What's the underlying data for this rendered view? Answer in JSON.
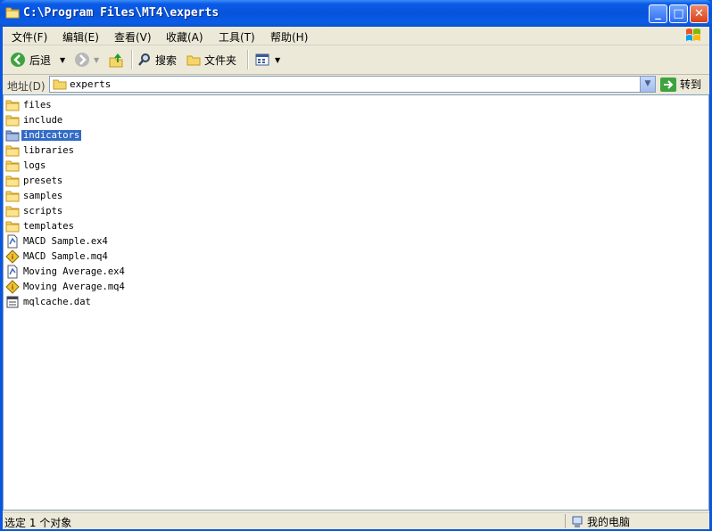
{
  "window": {
    "title": "C:\\Program Files\\MT4\\experts"
  },
  "menu": [
    {
      "label": "文件(F)"
    },
    {
      "label": "编辑(E)"
    },
    {
      "label": "查看(V)"
    },
    {
      "label": "收藏(A)"
    },
    {
      "label": "工具(T)"
    },
    {
      "label": "帮助(H)"
    }
  ],
  "toolbar": {
    "back_label": "后退",
    "search_label": "搜索",
    "folders_label": "文件夹"
  },
  "address": {
    "label": "地址(D)",
    "value": "experts",
    "go_label": "转到"
  },
  "files": [
    {
      "name": "files",
      "icon": "folder"
    },
    {
      "name": "include",
      "icon": "folder"
    },
    {
      "name": "indicators",
      "icon": "folder",
      "selected": true
    },
    {
      "name": "libraries",
      "icon": "folder"
    },
    {
      "name": "logs",
      "icon": "folder"
    },
    {
      "name": "presets",
      "icon": "folder"
    },
    {
      "name": "samples",
      "icon": "folder"
    },
    {
      "name": "scripts",
      "icon": "folder"
    },
    {
      "name": "templates",
      "icon": "folder"
    },
    {
      "name": "MACD Sample.ex4",
      "icon": "ex4-file"
    },
    {
      "name": "MACD Sample.mq4",
      "icon": "mq4-file"
    },
    {
      "name": "Moving Average.ex4",
      "icon": "ex4-file"
    },
    {
      "name": "Moving Average.mq4",
      "icon": "mq4-file"
    },
    {
      "name": "mqlcache.dat",
      "icon": "dat-file"
    }
  ],
  "status": {
    "left": "选定 1 个对象",
    "right": "我的电脑"
  },
  "colors": {
    "titlebar": "#0a5be8",
    "selection": "#316ac5",
    "chrome": "#ece9d8"
  }
}
